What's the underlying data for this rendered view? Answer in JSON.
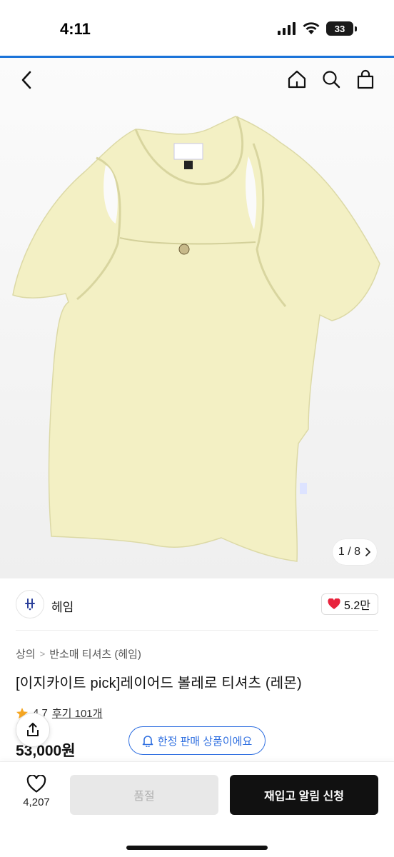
{
  "status_bar": {
    "time": "4:11",
    "battery": "33"
  },
  "hero": {
    "pager_text": "1 / 8",
    "image_count": 8,
    "current_image": 1
  },
  "brand": {
    "name": "헤임",
    "likes": "5.2만"
  },
  "product": {
    "breadcrumb": [
      "상의",
      "반소매 티셔츠 (헤임)"
    ],
    "title": "[이지카이트 pick]레이어드 볼레로 티셔츠 (레몬)",
    "rating": "4.7",
    "review_label": "후기 101개",
    "price": "53,000원",
    "limited_label": "한정 판매 상품이에요"
  },
  "bottom_bar": {
    "wish_count": "4,207",
    "soldout_label": "품절",
    "restock_label": "재입고 알림 신청"
  },
  "colors": {
    "accent": "#1a73d9",
    "heart": "#e8223c",
    "star": "#f5a623",
    "pill": "#2f6fe0"
  }
}
